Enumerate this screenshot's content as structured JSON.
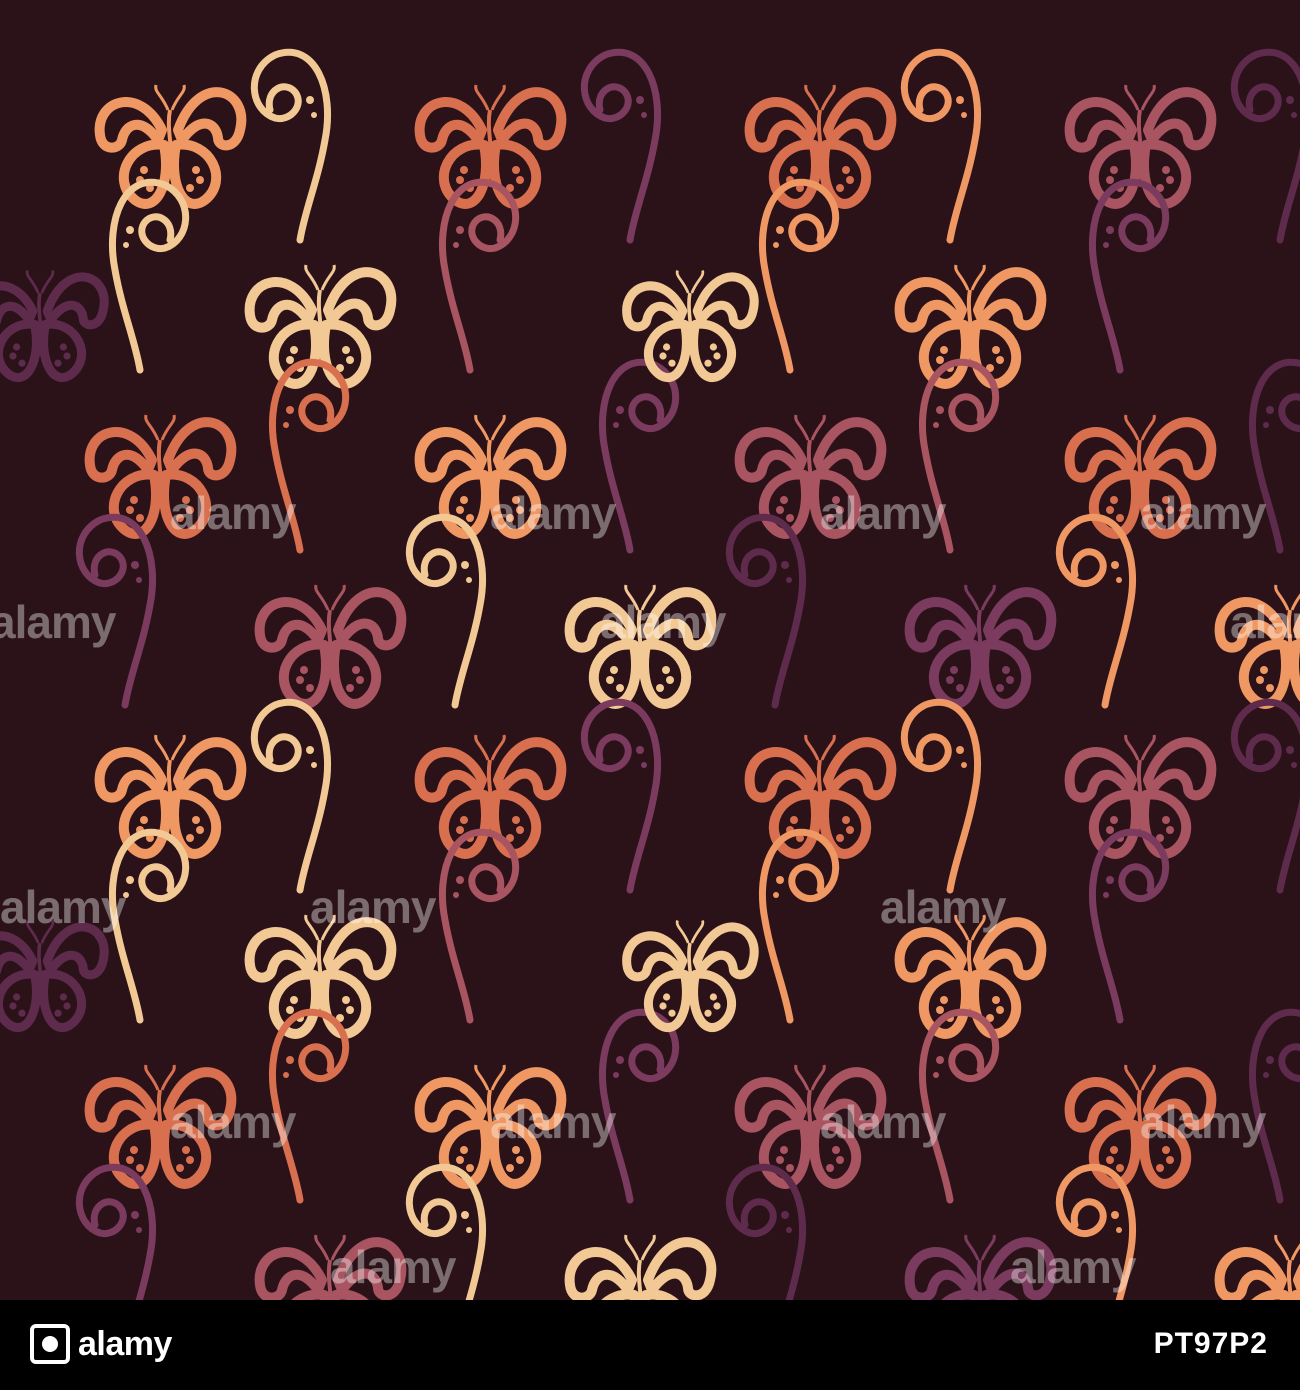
{
  "background_color": "#2b1219",
  "motif_colors": [
    "#f2c994",
    "#ef9863",
    "#d8704f",
    "#a85461",
    "#7b3b5e",
    "#5f2b4d"
  ],
  "motifs": [
    "butterfly-icon",
    "swirl-icon"
  ],
  "watermark": {
    "text": "alamy",
    "color": "rgba(255,255,255,0.38)"
  },
  "footer": {
    "logo_icon": "alamy-logo-icon",
    "logo_text": "alamy",
    "image_id": "PT97P2",
    "background": "#000000"
  }
}
